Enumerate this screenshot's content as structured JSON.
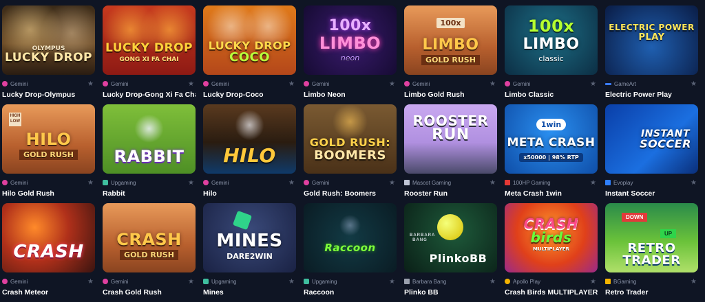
{
  "games": [
    {
      "title": "Lucky Drop-Olympus",
      "provider": "Gemini",
      "art_line1": "OLYMPUS",
      "art_line2": "LUCKY DROP",
      "provider_color": "#e040a0"
    },
    {
      "title": "Lucky Drop-Gong Xi Fa Chai",
      "provider": "Gemini",
      "art_line1": "LUCKY DROP",
      "art_line2": "GONG XI FA CHAI",
      "provider_color": "#e040a0"
    },
    {
      "title": "Lucky Drop-Coco",
      "provider": "Gemini",
      "art_line1": "LUCKY DROP",
      "art_line2": "COCO",
      "provider_color": "#e040a0"
    },
    {
      "title": "Limbo Neon",
      "provider": "Gemini",
      "art_line1": "100x",
      "art_line2": "LIMBO",
      "art_line3": "neon",
      "provider_color": "#e040a0"
    },
    {
      "title": "Limbo Gold Rush",
      "provider": "Gemini",
      "art_line1": "LIMBO",
      "art_line2": "GOLD RUSH",
      "art_badge": "100x",
      "provider_color": "#e040a0"
    },
    {
      "title": "Limbo Classic",
      "provider": "Gemini",
      "art_line1": "100x",
      "art_line2": "LIMBO",
      "art_line3": "classic",
      "provider_color": "#e040a0"
    },
    {
      "title": "Electric Power Play",
      "provider": "GameArt",
      "art_line1": "ELECTRIC POWER",
      "art_line2": "PLAY",
      "provider_color": "#3a7bff"
    },
    {
      "title": "Hilo Gold Rush",
      "provider": "Gemini",
      "art_line1": "HILO",
      "art_line2": "GOLD RUSH",
      "art_badge1": "HIGH",
      "art_badge2": "LOW",
      "provider_color": "#e040a0"
    },
    {
      "title": "Rabbit",
      "provider": "Upgaming",
      "art_line1": "RABBIT",
      "art_line2": "",
      "provider_color": "#3fbf9f"
    },
    {
      "title": "Hilo",
      "provider": "Gemini",
      "art_line1": "HILO",
      "art_line2": "",
      "provider_color": "#e040a0"
    },
    {
      "title": "Gold Rush: Boomers",
      "provider": "Gemini",
      "art_line1": "GOLD RUSH:",
      "art_line2": "BOOMERS",
      "provider_color": "#e040a0"
    },
    {
      "title": "Rooster Run",
      "provider": "Mascot Gaming",
      "art_line1": "ROOSTER",
      "art_line2": "RUN",
      "provider_color": "#c0c6d6"
    },
    {
      "title": "Meta Crash 1win",
      "provider": "100HP Gaming",
      "art_line1": "META CRASH",
      "art_line2": "x50000 | 98% RTP",
      "art_badge": "1win",
      "provider_color": "#e53935"
    },
    {
      "title": "Instant Soccer",
      "provider": "Evoplay",
      "art_line1": "INSTANT",
      "art_line2": "SOCCER",
      "provider_color": "#2f80ff"
    },
    {
      "title": "Crash Meteor",
      "provider": "Gemini",
      "art_line1": "CRASH",
      "art_line2": "",
      "provider_color": "#e040a0"
    },
    {
      "title": "Crash Gold Rush",
      "provider": "Gemini",
      "art_line1": "CRASH",
      "art_line2": "GOLD RUSH",
      "provider_color": "#e040a0"
    },
    {
      "title": "Mines",
      "provider": "Upgaming",
      "art_line1": "MINES",
      "art_line2": "DARE2WIN",
      "provider_color": "#3fbf9f"
    },
    {
      "title": "Raccoon",
      "provider": "Upgaming",
      "art_line1": "Raccoon",
      "art_line2": "",
      "provider_color": "#3fbf9f"
    },
    {
      "title": "Plinko BB",
      "provider": "Barbara Bang",
      "art_line1": "PlinkoBB",
      "art_line2": "BARBARA BANG",
      "provider_color": "#9aa0ad"
    },
    {
      "title": "Crash Birds MULTIPLAYER",
      "provider": "Apollo Play",
      "art_line1": "CRASH",
      "art_line2": "birds",
      "art_line3": "MULTIPLAYER",
      "provider_color": "#f5b400"
    },
    {
      "title": "Retro Trader",
      "provider": "BGaming",
      "art_line1": "RETRO",
      "art_line2": "TRADER",
      "art_badge1": "DOWN",
      "art_badge2": "UP",
      "provider_color": "#f5b400"
    }
  ],
  "colors": {
    "background": "#0f1524",
    "title": "#ffffff",
    "provider": "#8a93a8",
    "star": "#5a6275"
  }
}
